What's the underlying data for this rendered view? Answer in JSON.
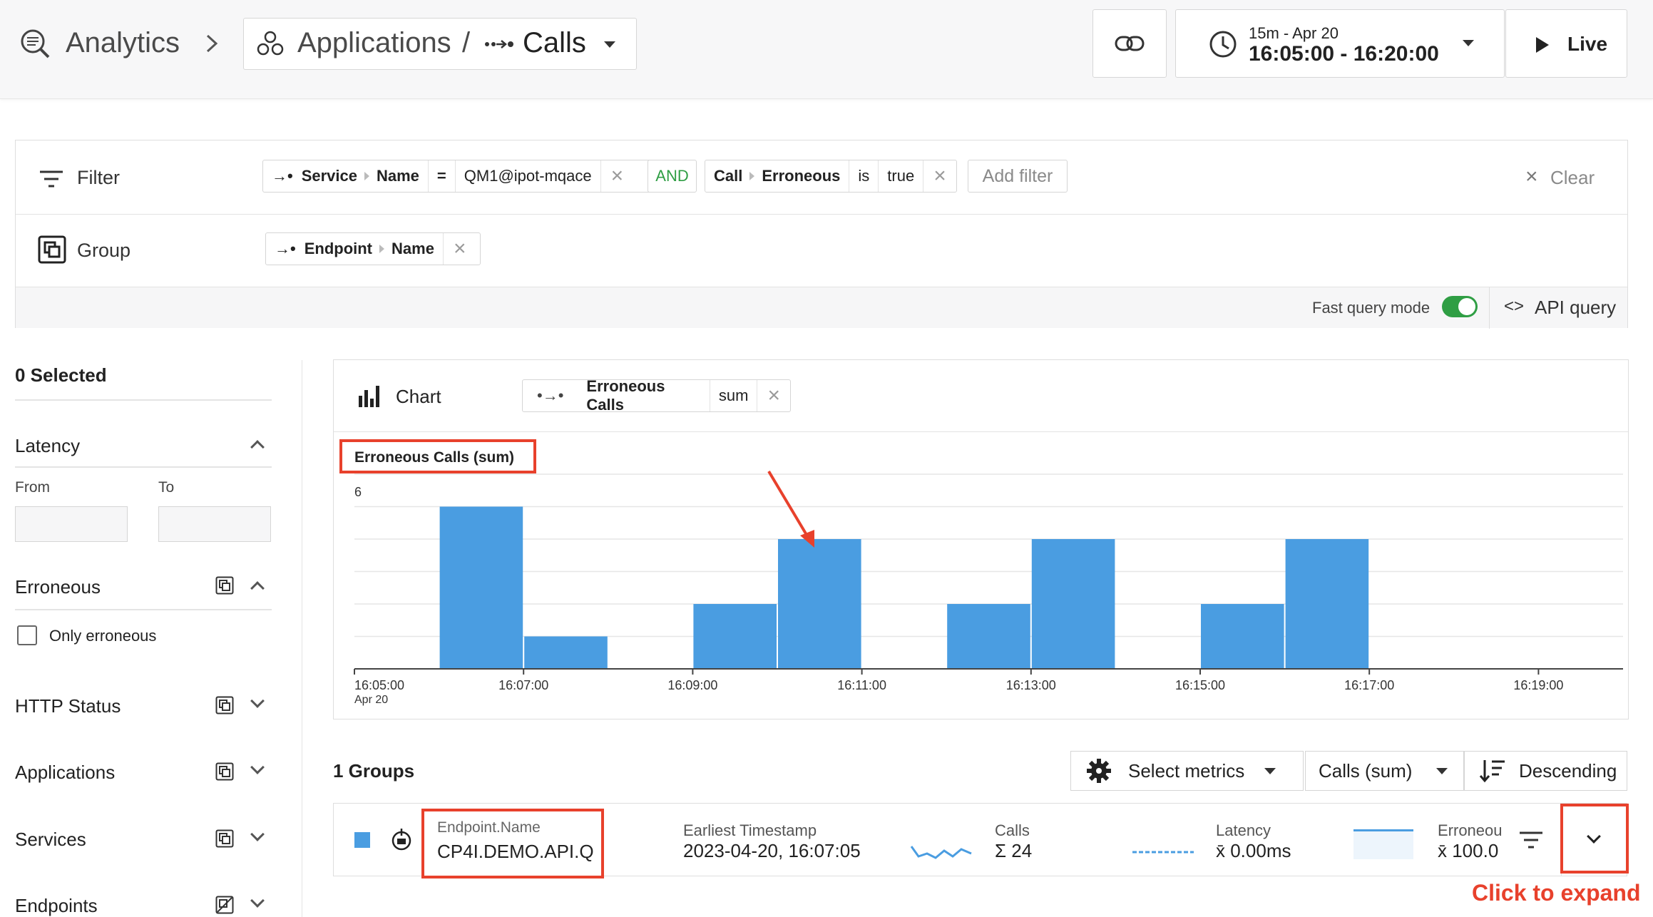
{
  "topbar": {
    "analytics": "Analytics",
    "applications": "Applications",
    "slash": "/",
    "calls": "Calls",
    "range_line1": "15m - Apr 20",
    "range_line2": "16:05:00 - 16:20:00",
    "live": "Live"
  },
  "filter": {
    "label": "Filter",
    "pill1": {
      "a": "Service",
      "b": "Name",
      "op": "=",
      "value": "QM1@ipot-mqace"
    },
    "and": "AND",
    "pill2": {
      "a": "Call",
      "b": "Erroneous",
      "op": "is",
      "value": "true"
    },
    "add": "Add filter",
    "clear": "Clear",
    "clear_icon": "×"
  },
  "group": {
    "label": "Group",
    "pill": {
      "a": "Endpoint",
      "b": "Name"
    }
  },
  "options": {
    "fast_query": "Fast query mode",
    "fast_query_on": true,
    "api": "API query"
  },
  "sidebar": {
    "selected": "0 Selected",
    "latency": "Latency",
    "from": "From",
    "to": "To",
    "erroneous": "Erroneous",
    "only_erroneous": "Only erroneous",
    "http_status": "HTTP Status",
    "applications": "Applications",
    "services": "Services",
    "endpoints": "Endpoints"
  },
  "chart_header": {
    "title": "Chart",
    "metric": "Erroneous Calls",
    "agg": "sum"
  },
  "chart_data": {
    "type": "bar",
    "title": "Erroneous Calls (sum)",
    "ylim": [
      0,
      6
    ],
    "y_tick_labels": [
      "6"
    ],
    "bar_color": "#4a9de1",
    "bar_width_minutes": 1,
    "x_tick_labels": [
      "16:05:00",
      "16:07:00",
      "16:09:00",
      "16:11:00",
      "16:13:00",
      "16:15:00",
      "16:17:00",
      "16:19:00"
    ],
    "x_tick_sublabel": "Apr 20",
    "bars": [
      {
        "x": "16:06:30",
        "value": 5
      },
      {
        "x": "16:07:30",
        "value": 1
      },
      {
        "x": "16:09:30",
        "value": 2
      },
      {
        "x": "16:10:30",
        "value": 4
      },
      {
        "x": "16:12:30",
        "value": 2
      },
      {
        "x": "16:13:30",
        "value": 4
      },
      {
        "x": "16:15:30",
        "value": 2
      },
      {
        "x": "16:16:30",
        "value": 4
      }
    ]
  },
  "groups": {
    "count": "1 Groups",
    "select_metrics": "Select metrics",
    "sort_metric": "Calls (sum)",
    "order": "Descending",
    "row": {
      "col1_label": "Endpoint.Name",
      "col1_value": "CP4I.DEMO.API.Q",
      "ts_label": "Earliest Timestamp",
      "ts_value": "2023-04-20, 16:07:05",
      "calls_label": "Calls",
      "calls_value": "Σ 24",
      "latency_label": "Latency",
      "latency_value": "x̄ 0.00ms",
      "err_label": "Erroneou",
      "err_value": "x̄ 100.0"
    }
  },
  "annotation": {
    "expand": "Click to expand",
    "color": "#e8412c"
  }
}
